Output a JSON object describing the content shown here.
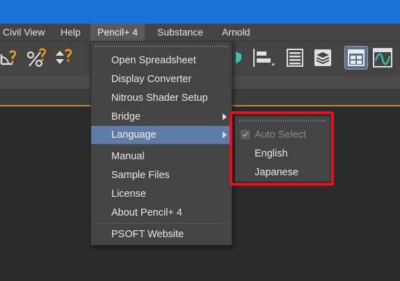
{
  "colors": {
    "title_bar": "#1e74d6",
    "highlight": "#5f7ba8",
    "callout_border": "#e8101a",
    "accent_orange": "#c88b32"
  },
  "menubar": {
    "items": [
      {
        "label": "Civil View"
      },
      {
        "label": "Help"
      },
      {
        "label": "Pencil+ 4"
      },
      {
        "label": "Substance"
      },
      {
        "label": "Arnold"
      }
    ],
    "active": "Pencil+ 4"
  },
  "toolbar": {
    "icons": [
      "snap-angle-icon",
      "percent-snap-icon",
      "spinner-snap-icon",
      "align-icon",
      "array-icon",
      "spreadsheet-icon",
      "layers-icon",
      "ribbon-icon",
      "curve-editor-icon"
    ]
  },
  "pencil_menu": {
    "items": [
      {
        "label": "Open Spreadsheet"
      },
      {
        "label": "Display Converter"
      },
      {
        "label": "Nitrous Shader Setup"
      },
      {
        "label": "Bridge"
      },
      {
        "label": "Language"
      },
      {
        "label": "Manual"
      },
      {
        "label": "Sample Files"
      },
      {
        "label": "License"
      },
      {
        "label": "About Pencil+ 4"
      },
      {
        "label": "PSOFT Website"
      }
    ],
    "highlighted": "Language"
  },
  "language_submenu": {
    "items": [
      {
        "label": "Auto Select",
        "checked": true,
        "enabled": false
      },
      {
        "label": "English"
      },
      {
        "label": "Japanese"
      }
    ]
  }
}
